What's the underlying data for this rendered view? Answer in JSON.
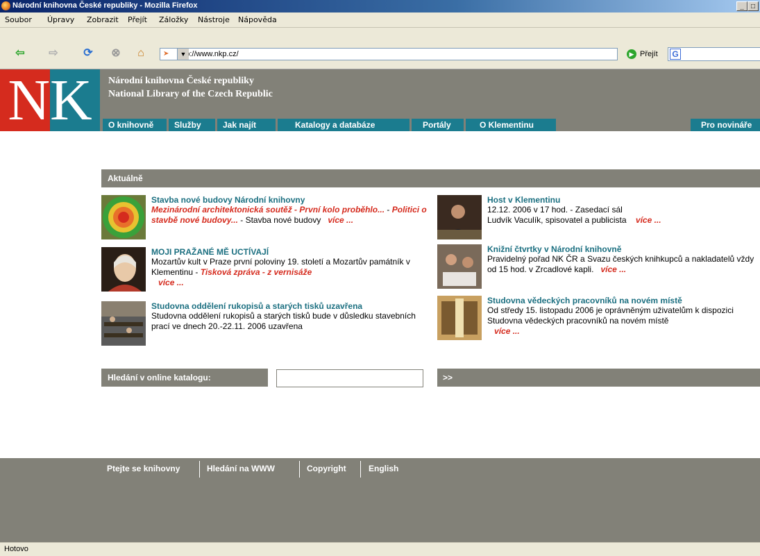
{
  "window": {
    "title": "Národní knihovna České republiky - Mozilla Firefox"
  },
  "menu": [
    "Soubor",
    "Úpravy",
    "Zobrazit",
    "Přejít",
    "Záložky",
    "Nástroje",
    "Nápověda"
  ],
  "navbar": {
    "url": "http://www.nkp.cz/",
    "go_label": "Přejít"
  },
  "site": {
    "name_cz": "Národní knihovna České republiky",
    "name_en": "National Library of the Czech Republic",
    "logo_left": "N",
    "logo_right": "K"
  },
  "mainnav": [
    "O knihovně",
    "Služby",
    "Jak najít",
    "Katalogy a databáze",
    "Portály",
    "O Klementinu",
    "Pro novináře"
  ],
  "aktualne": {
    "heading": "Aktuálně"
  },
  "news_left": [
    {
      "title": "Stavba nové budovy Národní knihovny",
      "link1": "Mezinárodní architektonická soutěž",
      "sep1": " - ",
      "link2": "První kolo proběhlo...",
      "sep2": " - ",
      "link3": "Politici o stavbě nové budovy...",
      "text": " - Stavba nové budovy",
      "more": "více ..."
    },
    {
      "title": "MOJI PRAŽANÉ MĚ UCTÍVAJÍ",
      "text": "Mozartův kult v Praze první poloviny 19. století a Mozartův památník v Klementinu - ",
      "link1": "Tisková zpráva",
      "sep1": " - ",
      "link2": "z vernisáže",
      "more": "více ..."
    },
    {
      "title": "Studovna oddělení rukopisů a starých tisků uzavřena",
      "text": "Studovna oddělení rukopisů a starých tisků bude v důsledku stavebních prací ve dnech 20.-22.11. 2006 uzavřena"
    }
  ],
  "news_right": [
    {
      "title": "Host v Klementinu",
      "line1": "12.12. 2006 v 17 hod. - Zasedací sál",
      "line2": "Ludvík Vaculík, spisovatel a publicista",
      "more": "více ..."
    },
    {
      "title": "Knižní čtvrtky v Národní knihovně",
      "text": "Pravidelný pořad NK ČR a Svazu českých knihkupců a nakladatelů vždy od 15 hod. v Zrcadlové kapli.",
      "more": "více ..."
    },
    {
      "title": "Studovna vědeckých pracovníků na novém místě",
      "text": "Od středy 15. listopadu 2006 je oprávněným uživatelům k dispozici Studovna vědeckých pracovníků na novém místě",
      "more": "více ..."
    }
  ],
  "catalog": {
    "label": "Hledání v online katalogu:",
    "value": "",
    "submit": ">>"
  },
  "footer": [
    "Ptejte se knihovny",
    "Hledání na WWW",
    "Copyright",
    "English"
  ],
  "status": "Hotovo",
  "colors": {
    "gray": "#828178",
    "teal": "#1b7c8f",
    "red": "#d52b1e"
  }
}
